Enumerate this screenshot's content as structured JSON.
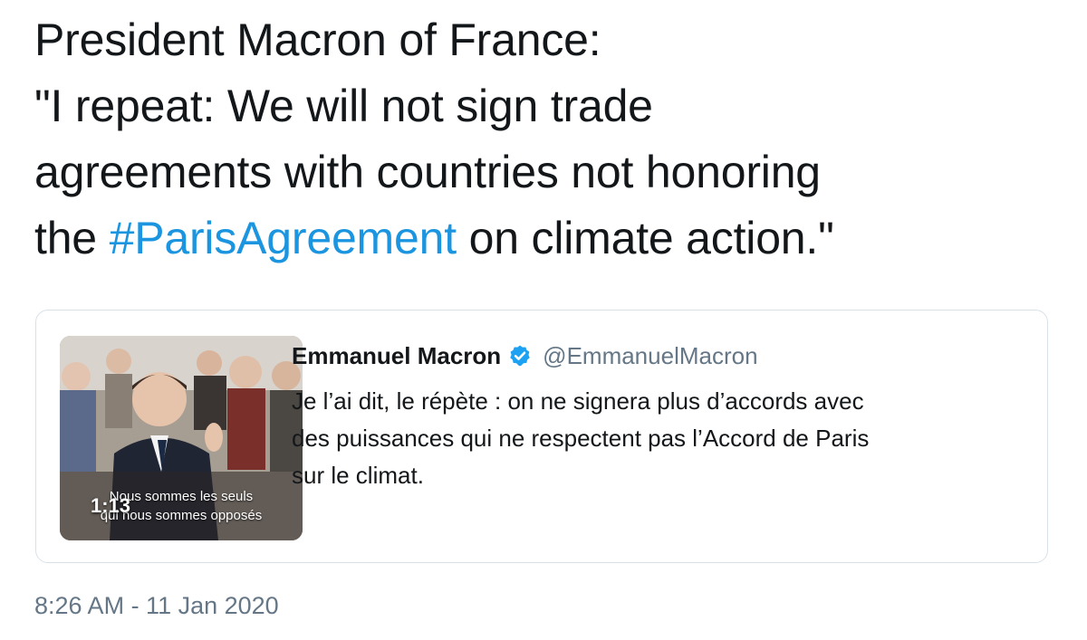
{
  "tweet": {
    "lines": [
      {
        "text": "President Macron of France:"
      },
      {
        "text": "\"I repeat: We will not sign trade"
      },
      {
        "text": "agreements with countries not honoring"
      },
      {
        "before": "the ",
        "hashtag": "#ParisAgreement",
        "after": " on climate action.\""
      }
    ],
    "timestamp": "8:26 AM - 11 Jan 2020"
  },
  "quoted_tweet": {
    "display_name": "Emmanuel Macron",
    "verified_icon": "verified-badge-icon",
    "handle": "@EmmanuelMacron",
    "text_lines": [
      "Je l’ai dit, le répète : on ne signera plus d’accords avec",
      "des puissances qui ne respectent pas l’Accord de Paris",
      "sur le climat."
    ],
    "media": {
      "duration": "1:13",
      "caption_lines": [
        "Nous sommes les seuls",
        "qui nous sommes opposés"
      ]
    }
  },
  "colors": {
    "hashtag": "#1b95e0",
    "verified": "#1da1f2",
    "secondary_text": "#657786",
    "card_border": "#d9e1e8"
  }
}
